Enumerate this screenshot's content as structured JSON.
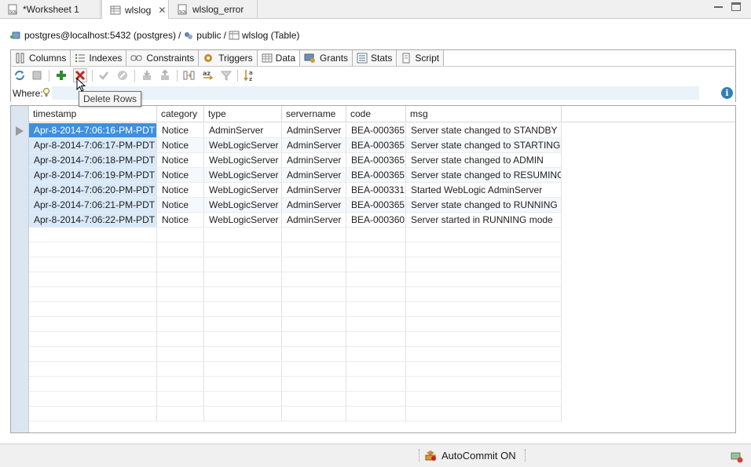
{
  "editor_tabs": [
    {
      "label": "*Worksheet 1",
      "icon": "sql-file-icon",
      "active": false
    },
    {
      "label": "wlslog",
      "icon": "table-icon",
      "active": true,
      "close": "✕"
    },
    {
      "label": "wlslog_error",
      "icon": "sql-file-icon",
      "active": false
    }
  ],
  "breadcrumb": {
    "connection": "postgres@localhost:5432 (postgres)",
    "sep1": "/",
    "schema": "public",
    "sep2": "/",
    "table": "wlslog (Table)"
  },
  "object_tabs": [
    {
      "label": "Columns",
      "icon": "columns-icon"
    },
    {
      "label": "Indexes",
      "icon": "indexes-icon"
    },
    {
      "label": "Constraints",
      "icon": "constraints-icon"
    },
    {
      "label": "Triggers",
      "icon": "triggers-icon"
    },
    {
      "label": "Data",
      "icon": "data-grid-icon",
      "active": true
    },
    {
      "label": "Grants",
      "icon": "grants-icon"
    },
    {
      "label": "Stats",
      "icon": "stats-icon"
    },
    {
      "label": "Script",
      "icon": "script-icon"
    }
  ],
  "toolbar": {
    "buttons": [
      "refresh-icon",
      "stop-icon",
      "insert-row-icon",
      "delete-rows-icon",
      "commit-icon",
      "rollback-icon",
      "import-icon",
      "export-icon",
      "freeze-columns-icon",
      "sort-icon",
      "filter-icon",
      "sort-az-icon"
    ]
  },
  "where": {
    "label": "Where:",
    "value": ""
  },
  "tooltip": {
    "text": "Delete Rows"
  },
  "grid": {
    "columns": [
      "timestamp",
      "category",
      "type",
      "servername",
      "code",
      "msg"
    ],
    "rows": [
      [
        "Apr-8-2014-7:06:16-PM-PDT",
        "Notice",
        "AdminServer",
        "AdminServer",
        "BEA-000365",
        "Server state changed to STANDBY"
      ],
      [
        "Apr-8-2014-7:06:17-PM-PDT",
        "Notice",
        "WebLogicServer",
        "AdminServer",
        "BEA-000365",
        "Server state changed to STARTING"
      ],
      [
        "Apr-8-2014-7:06:18-PM-PDT",
        "Notice",
        "WebLogicServer",
        "AdminServer",
        "BEA-000365",
        "Server state changed to ADMIN"
      ],
      [
        "Apr-8-2014-7:06:19-PM-PDT",
        "Notice",
        "WebLogicServer",
        "AdminServer",
        "BEA-000365",
        "Server state changed to RESUMING"
      ],
      [
        "Apr-8-2014-7:06:20-PM-PDT",
        "Notice",
        "WebLogicServer",
        "AdminServer",
        "BEA-000331",
        "Started WebLogic AdminServer"
      ],
      [
        "Apr-8-2014-7:06:21-PM-PDT",
        "Notice",
        "WebLogicServer",
        "AdminServer",
        "BEA-000365",
        "Server state changed to RUNNING"
      ],
      [
        "Apr-8-2014-7:06:22-PM-PDT",
        "Notice",
        "WebLogicServer",
        "AdminServer",
        "BEA-000360",
        "Server started in RUNNING mode"
      ]
    ],
    "selected_row": 0
  },
  "status": {
    "autocommit": "AutoCommit ON"
  },
  "colors": {
    "selection": "#3e8fde",
    "row_header": "#dbe6f1",
    "delete_red": "#c0271d",
    "insert_green": "#2e8b2e"
  }
}
